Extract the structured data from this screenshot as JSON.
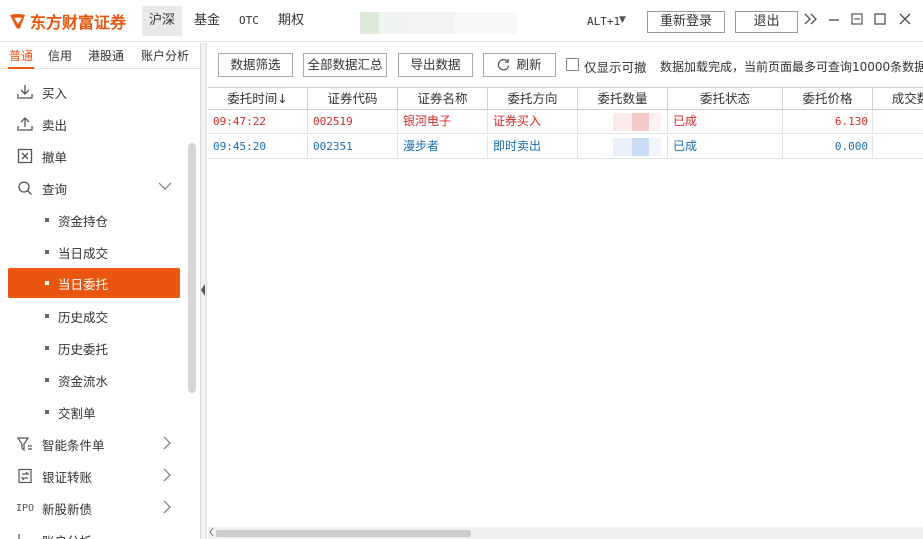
{
  "app": {
    "brand": "东方财富证券",
    "brand_color": "#e8560f",
    "market_tabs": [
      "沪深",
      "基金",
      "OTC",
      "期权"
    ],
    "hotkey": "ALT+1",
    "hotkey_arrow": "▼",
    "relogin_label": "重新登录",
    "logout_label": "退出"
  },
  "sidebar": {
    "top_tabs": [
      "普通",
      "信用",
      "港股通",
      "账户分析"
    ],
    "items": [
      {
        "label": "买入",
        "icon": "download-icon"
      },
      {
        "label": "卖出",
        "icon": "upload-icon"
      },
      {
        "label": "撤单",
        "icon": "cancel-box-icon"
      },
      {
        "label": "查询",
        "icon": "search-icon"
      }
    ],
    "query_sub": [
      "资金持仓",
      "当日成交",
      "当日委托",
      "历史成交",
      "历史委托",
      "资金流水",
      "交割单"
    ],
    "active_sub": "当日委托",
    "more_items": [
      {
        "label": "智能条件单",
        "icon": "filter-icon"
      },
      {
        "label": "银证转账",
        "icon": "transfer-icon"
      },
      {
        "label": "新股新债",
        "icon": "ipo-icon"
      },
      {
        "label": "账户分析",
        "icon": "chart-icon"
      }
    ],
    "ipo_text": "IPO"
  },
  "toolbar": {
    "filter_label": "数据筛选",
    "summary_label": "全部数据汇总",
    "export_label": "导出数据",
    "refresh_label": "刷新",
    "only_cancelable_label": "仅显示可撤",
    "status": "数据加载完成，当前页面最多可查询10000条数据。"
  },
  "table": {
    "columns": [
      "委托时间↓",
      "证券代码",
      "证券名称",
      "委托方向",
      "委托数量",
      "委托状态",
      "委托价格",
      "成交数"
    ],
    "rows": [
      {
        "time": "09:47:22",
        "code": "002519",
        "name": "银河电子",
        "direction": "证券买入",
        "qty": "",
        "status": "已成",
        "price": "6.130",
        "kind": "buy"
      },
      {
        "time": "09:45:20",
        "code": "002351",
        "name": "漫步者",
        "direction": "即时卖出",
        "qty": "",
        "status": "已成",
        "price": "0.000",
        "kind": "sell"
      }
    ]
  }
}
